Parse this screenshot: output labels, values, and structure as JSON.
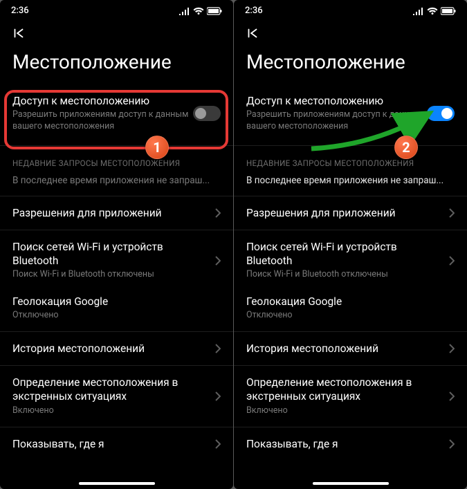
{
  "status": {
    "time": "2:36"
  },
  "page": {
    "title": "Местоположение"
  },
  "access": {
    "title": "Доступ к местоположению",
    "sub": "Разрешить приложениям доступ к данным вашего местоположения"
  },
  "section_recent": {
    "header": "НЕДАВНИЕ ЗАПРОСЫ МЕСТОПОЛОЖЕНИЯ",
    "note": "В последнее время приложения не запраш..."
  },
  "rows": {
    "perms": {
      "title": "Разрешения для приложений"
    },
    "wifi": {
      "title": "Поиск сетей Wi-Fi и устройств Bluetooth",
      "sub": "Поиск Wi-Fi и Bluetooth отключены"
    },
    "google": {
      "title": "Геолокация Google",
      "sub": "Отключено"
    },
    "history": {
      "title": "История местоположений"
    },
    "emerg": {
      "title": "Определение местоположения в экстренных ситуациях",
      "sub": "Включено"
    },
    "show": {
      "title": "Показывать, где я"
    }
  },
  "badges": {
    "one": "1",
    "two": "2"
  },
  "left_toggle_on": false,
  "right_toggle_on": true
}
